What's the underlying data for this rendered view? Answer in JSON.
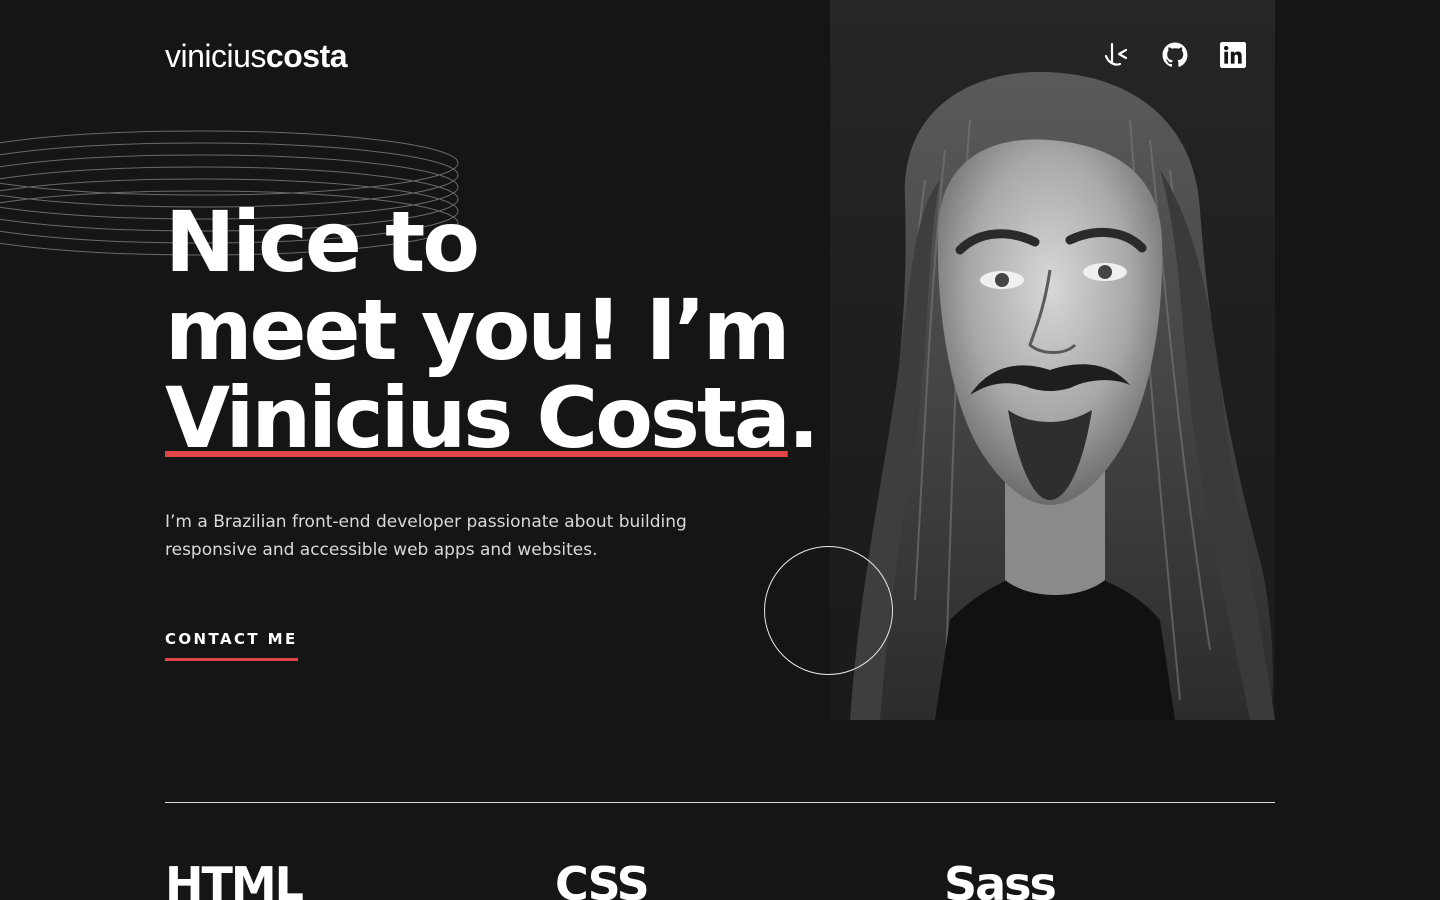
{
  "header": {
    "logo_first": "vinicius",
    "logo_last": "costa",
    "socials": [
      {
        "name": "frontend-mentor-icon"
      },
      {
        "name": "github-icon"
      },
      {
        "name": "linkedin-icon"
      }
    ]
  },
  "hero": {
    "line1": "Nice to",
    "line2": "meet you! I’m",
    "name": "Vinicius Costa",
    "period": ".",
    "intro": "I’m a Brazilian front-end developer passionate about building responsive and accessible web apps and websites.",
    "cta_label": "CONTACT ME"
  },
  "skills": [
    "HTML",
    "CSS",
    "Sass"
  ],
  "colors": {
    "background": "#151515",
    "accent": "#e04646",
    "text": "#ffffff"
  }
}
